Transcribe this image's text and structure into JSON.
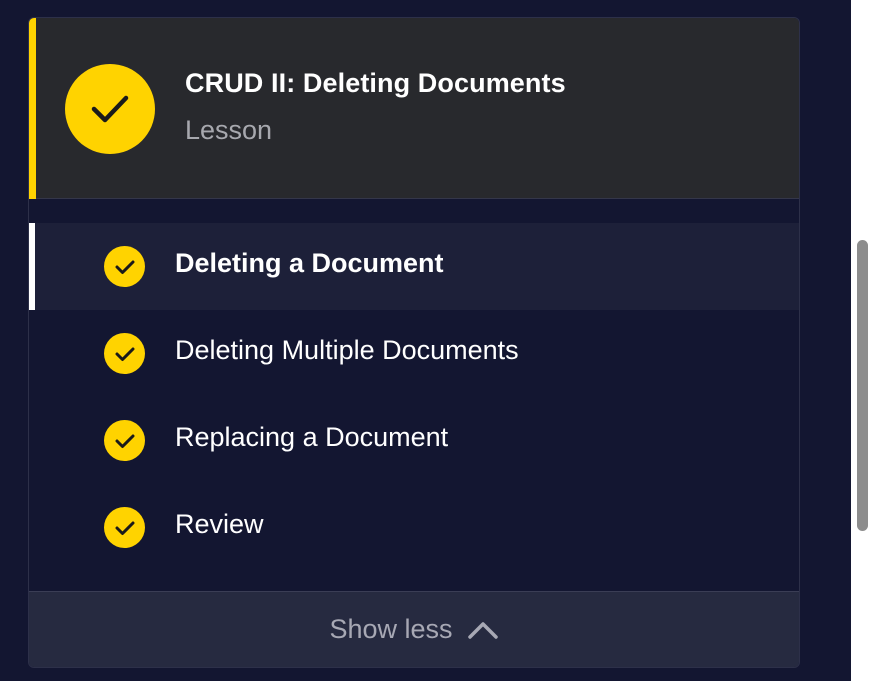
{
  "lesson": {
    "title": "CRUD II: Deleting Documents",
    "type": "Lesson",
    "status_icon": "check-circle-icon",
    "accent_color": "#ffd300"
  },
  "items": [
    {
      "label": "Deleting a Document",
      "active": true,
      "completed": true
    },
    {
      "label": "Deleting Multiple Documents",
      "active": false,
      "completed": true
    },
    {
      "label": "Replacing a Document",
      "active": false,
      "completed": true
    },
    {
      "label": "Review",
      "active": false,
      "completed": true
    }
  ],
  "toggle": {
    "label": "Show less",
    "icon": "chevron-up-icon"
  },
  "colors": {
    "background": "#131631",
    "header_bg": "#28292d",
    "active_item_bg": "#1d2039",
    "check": "#ffd300"
  }
}
